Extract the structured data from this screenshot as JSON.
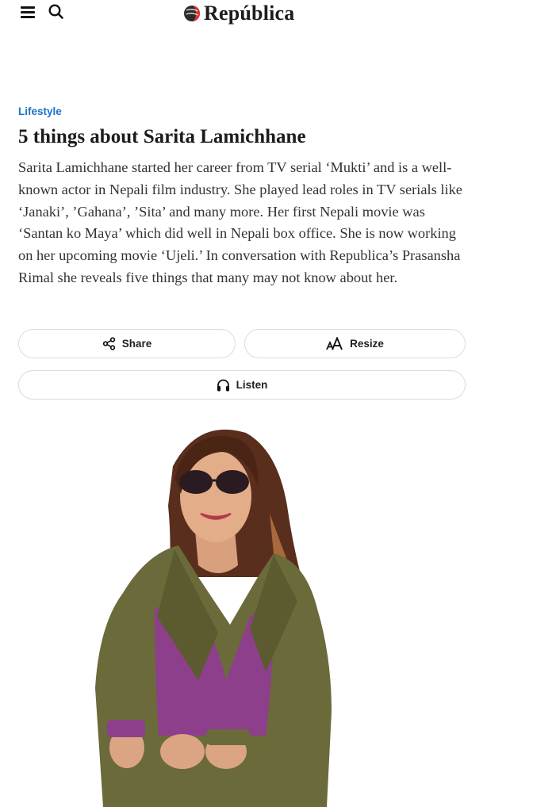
{
  "header": {
    "logo_text": "República",
    "menu_icon": "hamburger-icon",
    "search_icon": "search-icon"
  },
  "article": {
    "category": "Lifestyle",
    "title": "5 things about Sarita Lamichhane",
    "summary": "Sarita Lamichhane started her career from TV serial ‘Mukti’ and is a well-known actor in Nepali film industry.  She played lead roles in TV serials like ‘Janaki’, ’Gahana’, ’Sita’ and many more.  Her first Nepali movie was ‘Santan ko Maya’ which did well in Nepali box office. She is now working on her upcoming movie ‘Ujeli.’ In conversation with Republica’s Prasansha Rimal she reveals five things that many may not know about her."
  },
  "actions": {
    "share_label": "Share",
    "resize_label": "Resize",
    "listen_label": "Listen"
  },
  "colors": {
    "category": "#1a73c8",
    "text": "#333333",
    "jacket": "#6b6a3a",
    "top": "#8e3f8c"
  }
}
